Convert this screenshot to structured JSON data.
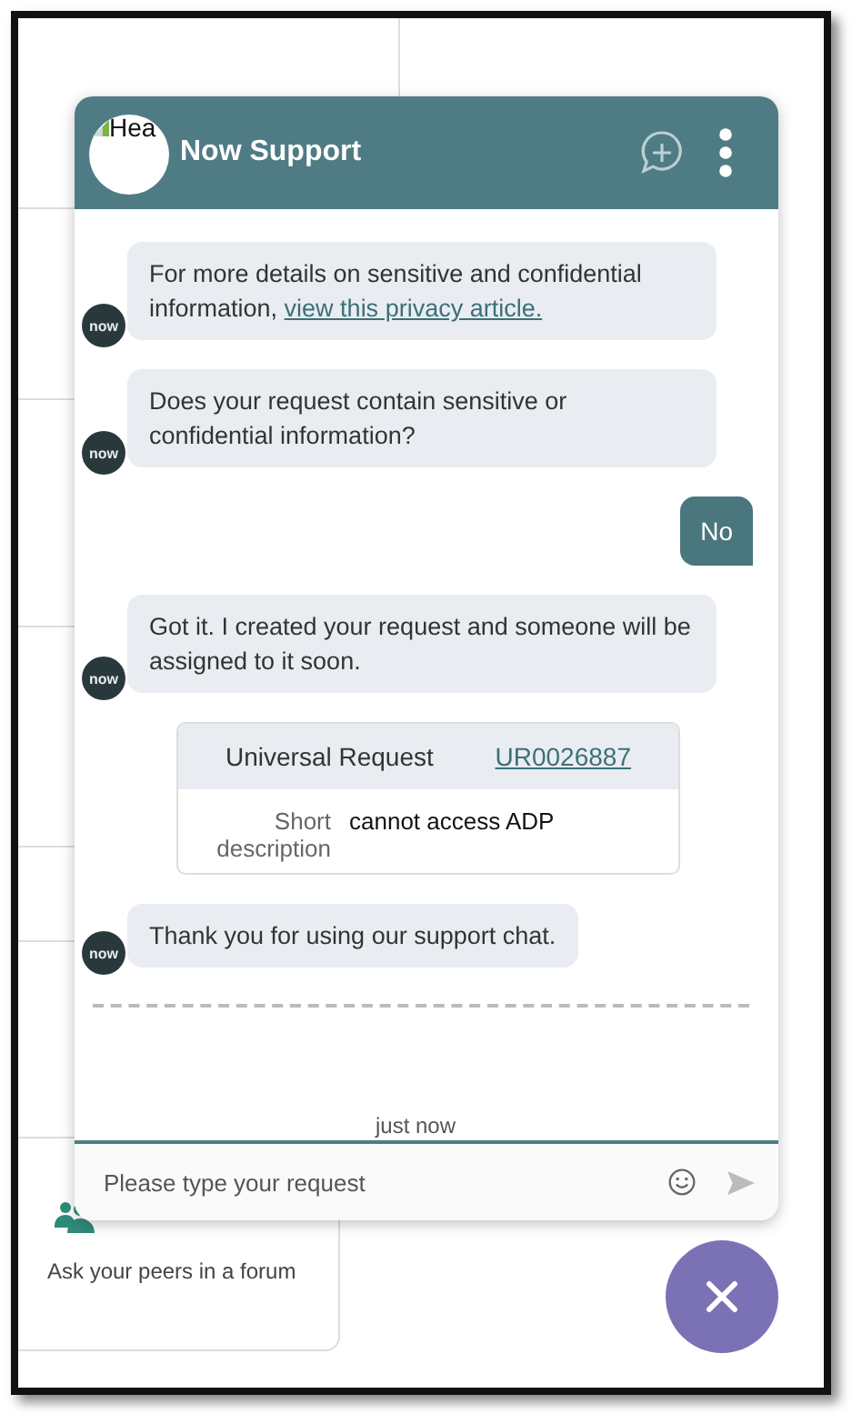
{
  "background": {
    "card": {
      "subtitle": "Ask your peers in a forum"
    }
  },
  "chat": {
    "header": {
      "logo_alt": "Hea",
      "title": "Now Support"
    },
    "messages": [
      {
        "kind": "bot",
        "avatar": "now",
        "text": "For more details on sensitive and confidential information, ",
        "link": "view this privacy article."
      },
      {
        "kind": "bot",
        "avatar": "now",
        "text": "Does your request contain sensitive or confidential information?"
      },
      {
        "kind": "user",
        "text": "No"
      },
      {
        "kind": "bot",
        "avatar": "now",
        "text": "Got it. I created your request and someone will be assigned to it soon."
      },
      {
        "kind": "record",
        "title": "Universal Request",
        "number": "UR0026887",
        "field_label": "Short description",
        "field_value": "cannot access ADP"
      },
      {
        "kind": "bot",
        "avatar": "now",
        "text": "Thank you for using our support chat."
      }
    ],
    "timestamp": "just now",
    "input": {
      "placeholder": "Please type your request"
    }
  }
}
